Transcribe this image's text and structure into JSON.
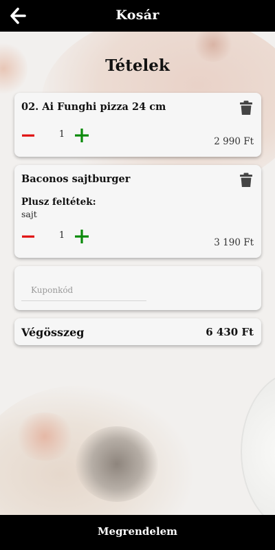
{
  "header": {
    "title": "Kosár",
    "back_icon": "arrow-left-icon"
  },
  "section_title": "Tételek",
  "cart": {
    "items": [
      {
        "name": "02. Ai Funghi pizza 24 cm",
        "quantity": "1",
        "price": "2 990 Ft",
        "extras_label": "",
        "extras_value": ""
      },
      {
        "name": "Baconos sajtburger",
        "quantity": "1",
        "price": "3 190 Ft",
        "extras_label": "Plusz feltétek:",
        "extras_value": "sajt"
      }
    ]
  },
  "coupon": {
    "placeholder": "Kuponkód",
    "value": ""
  },
  "total": {
    "label": "Végösszeg",
    "value": "6 430 Ft"
  },
  "order_button": {
    "label": "Megrendelem"
  },
  "colors": {
    "minus": "#e01010",
    "plus": "#0a8a0a",
    "trash": "#444444",
    "bar": "#000000"
  }
}
